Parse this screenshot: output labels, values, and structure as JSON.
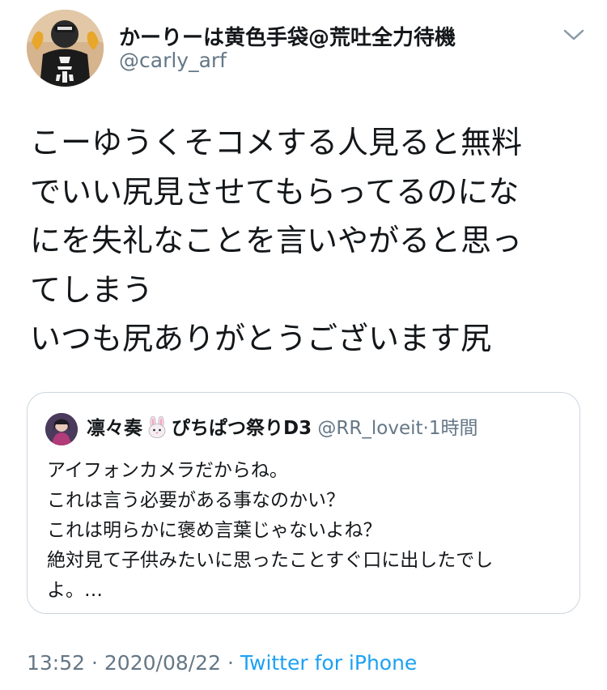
{
  "author": {
    "display_name": "かーりーは黄色手袋@荒吐全力待機",
    "handle": "@carly_arf",
    "avatar_icon": "user-avatar-photo"
  },
  "menu_icon": "chevron-down-icon",
  "tweet": {
    "lines": [
      "こーゆうくそコメする人見ると無料",
      "でいい尻見させてもらってるのにな",
      "にを失礼なことを言いやがると思っ",
      "てしまう",
      "いつも尻ありがとうございます尻"
    ]
  },
  "quote": {
    "name": "凛々奏",
    "name_emoji": "rabbit-face-emoji",
    "name_suffix": "ぴちぱつ祭りD3",
    "handle": "@RR_loveit",
    "separator": "·",
    "time": "1時間",
    "lines": [
      "アイフォンカメラだからね。",
      "これは言う必要がある事なのかい？",
      "これは明らかに褒め言葉じゃないよね？",
      "絶対見て子供みたいに思ったことすぐ口に出したでし",
      "よ。…"
    ]
  },
  "meta": {
    "time": "13:52",
    "sep1": "·",
    "date": "2020/08/22",
    "sep2": "·",
    "source": "Twitter for iPhone"
  },
  "colors": {
    "text": "#14171a",
    "secondary": "#657786",
    "link": "#1da1f2",
    "border": "#ccd6dd"
  }
}
